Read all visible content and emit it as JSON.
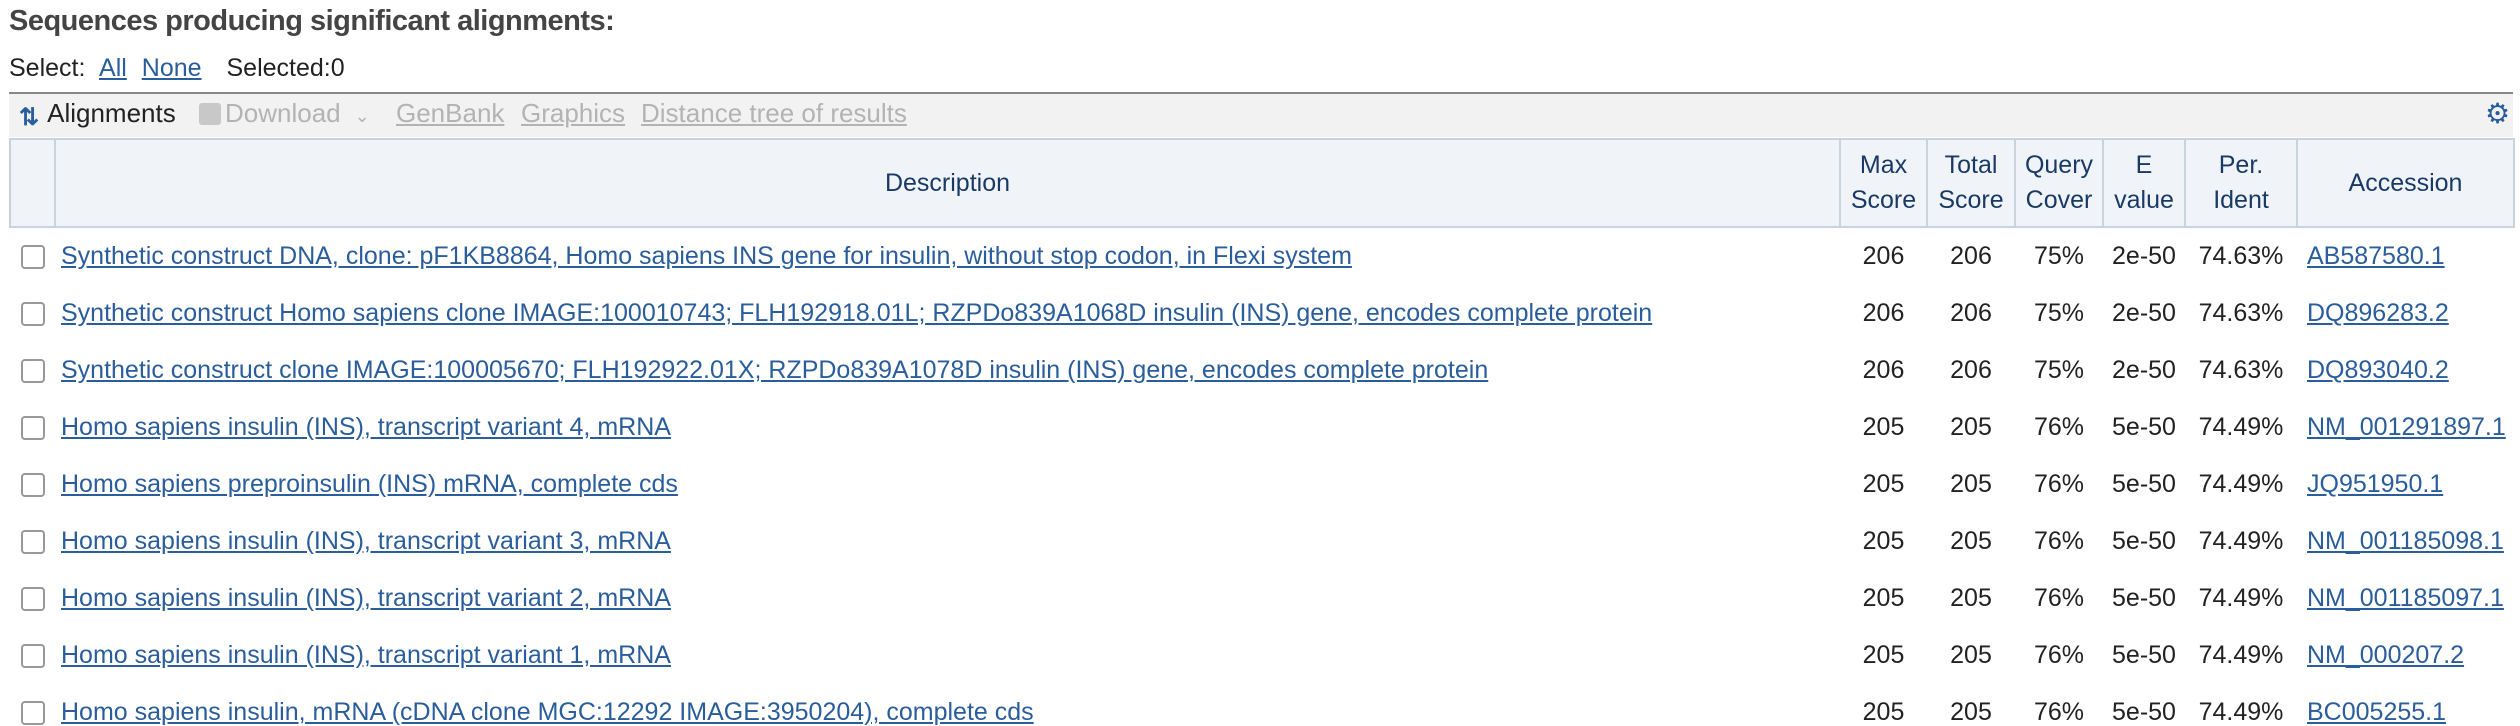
{
  "heading": "Sequences producing significant alignments:",
  "select": {
    "label": "Select:",
    "all": "All",
    "none": "None",
    "selected": "Selected:0"
  },
  "toolbar": {
    "alignments": "Alignments",
    "download": "Download",
    "genbank": "GenBank",
    "graphics": "Graphics",
    "distance_tree": "Distance tree of results"
  },
  "columns": {
    "description": "Description",
    "max_score": [
      "Max",
      "Score"
    ],
    "total_score": [
      "Total",
      "Score"
    ],
    "query_cover": [
      "Query",
      "Cover"
    ],
    "e_value": [
      "E",
      "value"
    ],
    "per_ident": [
      "Per.",
      "Ident"
    ],
    "accession": "Accession"
  },
  "rows": [
    {
      "description": "Synthetic construct DNA, clone: pF1KB8864, Homo sapiens INS gene for insulin, without stop codon, in Flexi system",
      "max_score": "206",
      "total_score": "206",
      "query_cover": "75%",
      "e_value": "2e-50",
      "per_ident": "74.63%",
      "accession": "AB587580.1"
    },
    {
      "description": "Synthetic construct Homo sapiens clone IMAGE:100010743; FLH192918.01L; RZPDo839A1068D insulin (INS) gene, encodes complete protein",
      "max_score": "206",
      "total_score": "206",
      "query_cover": "75%",
      "e_value": "2e-50",
      "per_ident": "74.63%",
      "accession": "DQ896283.2"
    },
    {
      "description": "Synthetic construct clone IMAGE:100005670; FLH192922.01X; RZPDo839A1078D insulin (INS) gene, encodes complete protein",
      "max_score": "206",
      "total_score": "206",
      "query_cover": "75%",
      "e_value": "2e-50",
      "per_ident": "74.63%",
      "accession": "DQ893040.2"
    },
    {
      "description": "Homo sapiens insulin (INS), transcript variant 4, mRNA",
      "max_score": "205",
      "total_score": "205",
      "query_cover": "76%",
      "e_value": "5e-50",
      "per_ident": "74.49%",
      "accession": "NM_001291897.1"
    },
    {
      "description": "Homo sapiens preproinsulin (INS) mRNA, complete cds",
      "max_score": "205",
      "total_score": "205",
      "query_cover": "76%",
      "e_value": "5e-50",
      "per_ident": "74.49%",
      "accession": "JQ951950.1"
    },
    {
      "description": "Homo sapiens insulin (INS), transcript variant 3, mRNA",
      "max_score": "205",
      "total_score": "205",
      "query_cover": "76%",
      "e_value": "5e-50",
      "per_ident": "74.49%",
      "accession": "NM_001185098.1"
    },
    {
      "description": "Homo sapiens insulin (INS), transcript variant 2, mRNA",
      "max_score": "205",
      "total_score": "205",
      "query_cover": "76%",
      "e_value": "5e-50",
      "per_ident": "74.49%",
      "accession": "NM_001185097.1"
    },
    {
      "description": "Homo sapiens insulin (INS), transcript variant 1, mRNA",
      "max_score": "205",
      "total_score": "205",
      "query_cover": "76%",
      "e_value": "5e-50",
      "per_ident": "74.49%",
      "accession": "NM_000207.2"
    },
    {
      "description": "Homo sapiens insulin, mRNA (cDNA clone MGC:12292 IMAGE:3950204), complete cds",
      "max_score": "205",
      "total_score": "205",
      "query_cover": "76%",
      "e_value": "5e-50",
      "per_ident": "74.49%",
      "accession": "BC005255.1"
    }
  ],
  "icons": {
    "alignments": "alignments-icon",
    "download": "save-icon",
    "settings": "gear-icon"
  },
  "colors": {
    "link": "#2a5d9c",
    "header_bg": "#f0f4f9",
    "disabled": "#b3b3b3"
  }
}
